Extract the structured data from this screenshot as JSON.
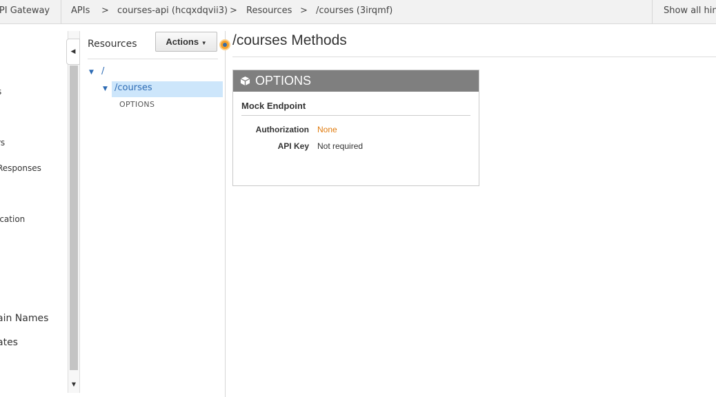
{
  "topbar": {
    "service": "API Gateway",
    "breadcrumb": {
      "apis": "APIs",
      "sep": ">",
      "api": "courses-api (hcqxdqvii3)",
      "resources": "Resources",
      "resource": "/courses (3irqmf)"
    },
    "hints": "Show all hints"
  },
  "leftnav": {
    "items": [
      "s",
      "rs",
      "Responses",
      "ication",
      "ain Names",
      "ates"
    ]
  },
  "resources": {
    "title": "Resources",
    "actions_label": "Actions",
    "tree": {
      "root": "/",
      "child": "/courses",
      "method": "OPTIONS"
    }
  },
  "main": {
    "title": "/courses Methods",
    "method": {
      "name": "OPTIONS",
      "integration": "Mock Endpoint",
      "authorization_label": "Authorization",
      "authorization_value": "None",
      "apikey_label": "API Key",
      "apikey_value": "Not required"
    }
  },
  "colors": {
    "accent_blue": "#2d6bb4",
    "selected_row": "#cde6fb",
    "authorization_none": "#e07a0c",
    "method_header": "#7f7f7f"
  }
}
